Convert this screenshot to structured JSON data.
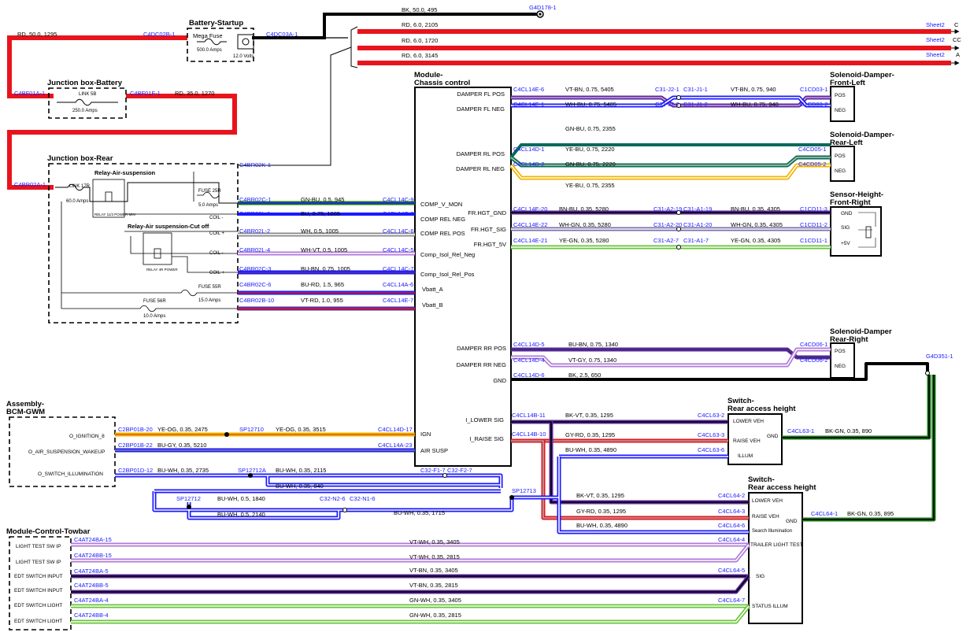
{
  "components": {
    "battery": {
      "title": "Battery-Startup",
      "fuse_label": "Mega Fuse",
      "fuse_rating": "500.0 Amps",
      "volts": "12.0 Volts"
    },
    "jb_battery": {
      "title": "Junction box-Battery",
      "link": "LINK 5B",
      "rating": "250.0 Amps"
    },
    "jb_rear": {
      "title": "Junction box-Rear",
      "link": "LINK 17R",
      "link_rating": "60.0 Amps",
      "relay1_title": "Relay-Air-suspension",
      "relay1_sub": "RELAY 11/3 POWER MIN",
      "relay2_title": "Relay-Air suspension-Cut off",
      "relay2_sub": "RELAY 4R POWER",
      "fuse25": "FUSE 25R",
      "fuse25_rating": "5.0 Amps",
      "fuse55": "FUSE 55R",
      "fuse55_rating": "15.0 Amps",
      "fuse56": "FUSE 56R",
      "fuse56_rating": "10.0 Amps",
      "coil_minus_1": "COIL -",
      "coil_plus_1": "COIL +",
      "coil_minus_2": "COIL -",
      "coil_plus_2": "COIL +"
    },
    "module": {
      "title1": "Module-",
      "title2": "Chassis control"
    },
    "sd_fl": {
      "t1": "Solenoid-Damper-",
      "t2": "Front-Left",
      "p1": "POS",
      "p2": "NEG"
    },
    "sd_rl": {
      "t1": "Solenoid-Damper-",
      "t2": "Rear-Left",
      "p1": "POS",
      "p2": "NEG"
    },
    "sensor": {
      "t1": "Sensor-Height-",
      "t2": "Front-Right",
      "p1": "GND",
      "p2": "SIG",
      "p3": "+5V"
    },
    "sd_rr": {
      "t1": "Solenoid-Damper",
      "t2": "Rear-Right",
      "p1": "POS",
      "p2": "NEG"
    },
    "bcm": {
      "t1": "Assembly-",
      "t2": "BCM-GWM",
      "p1": "O_IGNITION_8",
      "p2": "O_AIR_SUSPENSION_WAKEUP",
      "p3": "O_SWITCH_ILLUMINATION"
    },
    "sw1": {
      "t1": "Switch-",
      "t2": "Rear access height",
      "p1": "LOWER VEH",
      "p2": "RAISE VEH",
      "p3": "ILLUM",
      "gnd": "GND"
    },
    "sw2": {
      "t1": "Switch-",
      "t2": "Rear access height",
      "p1": "LOWER VEH",
      "p2": "RAISE VEH",
      "p3": "Search Illumination",
      "p4": "TRAILER LIGHT TEST",
      "p5": "SIG",
      "p6": "STATUS ILLUM",
      "gnd": "GND"
    },
    "towbar": {
      "title": "Module-Control-Towbar",
      "p1": "LIGHT TEST SW IP",
      "p2": "LIGHT TEST SW IP",
      "p3": "EDT SWITCH INPUT",
      "p4": "EDT SWITCH INPUT",
      "p5": "EDT SWITCH LIGHT",
      "p6": "EDT SWITCH LIGHT"
    }
  },
  "module_pins": [
    "DAMPER FL POS",
    "DAMPER FL NEG",
    "DAMPER RL POS",
    "DAMPER RL NEG",
    "FR.HGT_GND",
    "FR.HGT_SIG",
    "FR.HGT_5V",
    "COMP_V_MON",
    "COMP REL NEG",
    "COMP REL POS",
    "Comp_Isol_Rel_Neg",
    "Comp_Isol_Rel_Pos",
    "Vbatt_A",
    "Vbatt_B",
    "DAMPER RR POS",
    "DAMPER RR NEG",
    "GND",
    "I_LOWER SIG",
    "I_RAISE SIG",
    "IGN",
    "AIR SUSP"
  ],
  "connectors": [
    "C4DC02B-1",
    "C4DC03A-1",
    "G4D178-1",
    "C4BF01A-1",
    "C4BF01F-1",
    "C4BR02A-1",
    "C4BR02K-1",
    "C4BR02C-1",
    "C4BR02L-6",
    "C4BR02L-2",
    "C4BR02L-4",
    "C4BR02C-3",
    "C4BR02C-6",
    "C4BR02B-10",
    "C4CL14C-9",
    "C4CL14C-8",
    "C4CL14C-6",
    "C4CL14C-5",
    "C4CL14C-7",
    "C4CL14A-6",
    "C4CL14E-7",
    "C4CL14E-6",
    "C4CL14E-1",
    "C31-J2-1",
    "C31-J1-1",
    "C31-J2-2",
    "C31-J1-2",
    "C1CD03-1",
    "C1CD03-2",
    "C4CL14D-1",
    "C4CL14D-2",
    "C4CD05-1",
    "C4CD05-2",
    "C4CL14E-20",
    "C4CL14E-22",
    "C4CL14E-21",
    "C31-A2-19",
    "C31-A1-19",
    "C31-A2-20",
    "C31-A1-20",
    "C31-A2-7",
    "C31-A1-7",
    "C1CD11-3",
    "C1CD11-2",
    "C1CD11-1",
    "C4CL14D-5",
    "C4CL14D-4",
    "C4CL14D-6",
    "C4CD06-1",
    "C4CD06-2",
    "G4D351-1",
    "C4CL14B-11",
    "C4CL14B-10",
    "C4CL63-2",
    "C4CL63-3",
    "C4CL63-6",
    "C4CL63-1",
    "C2BP01B-20",
    "C2BP01B-22",
    "C2BP01D-12",
    "C4CL14D-17",
    "C4CL14A-23",
    "SP12710",
    "SP12712A",
    "SP12712",
    "SP12713",
    "C32-F1-7",
    "C32-F2-7",
    "C32-N2-6",
    "C32-N1-6",
    "C4CL64-2",
    "C4CL64-3",
    "C4CL64-6",
    "C4CL64-1",
    "C4CL64-4",
    "C4CL64-5",
    "C4CL64-7",
    "C4AT24BA-15",
    "C4AT24BB-15",
    "C4AT24BA-5",
    "C4AT24BB-5",
    "C4AT24BA-4",
    "C4AT24BB-4"
  ],
  "wires": [
    "RD, 50.0, 1295",
    "BK, 50.0, 495",
    "RD, 6.0, 2105",
    "RD, 6.0, 1720",
    "RD, 6.0, 3145",
    "RD, 35.0, 1270",
    "GN-BU, 0.5, 945",
    "BU, 0.75, 1005",
    "WH, 0.5, 1005",
    "WH-VT, 0.5, 1005",
    "BU-BN, 0.75, 1005",
    "BU-RD, 1.5, 965",
    "VT-RD, 1.0, 955",
    "VT-BN, 0.75, 5405",
    "VT-BN, 0.75, 940",
    "WH-BU, 0.75, 5405",
    "WH-BU, 0.75, 940",
    "GN-BU, 0.75, 2355",
    "YE-BU, 0.75, 2220",
    "GN-BU, 0.75, 2220",
    "YE-BU, 0.75, 2355",
    "BN-BU, 0.35, 5280",
    "BN-BU, 0.35, 4305",
    "WH-GN, 0.35, 5280",
    "WH-GN, 0.35, 4305",
    "YE-GN, 0.35, 5280",
    "YE-GN, 0.35, 4305",
    "BU-BN, 0.75, 1340",
    "VT-GY, 0.75, 1340",
    "BK, 2.5, 650",
    "BK-VT, 0.35, 1295",
    "GY-RD, 0.35, 1295",
    "BU-WH, 0.35, 4890",
    "BK-GN, 0.35, 890",
    "YE-OG, 0.35, 2475",
    "YE-OG, 0.35, 3515",
    "BU-GY, 0.35, 5210",
    "BU-WH, 0.35, 2735",
    "BU-WH, 0.35, 2115",
    "BU-WH, 0.35, 840",
    "BU-WH, 0.5, 1840",
    "BU-WH, 0.5, 2140",
    "BU-WH, 0.35, 1715",
    "BK-VT, 0.35, 1295",
    "GY-RD, 0.35, 1295",
    "BU-WH, 0.35, 4890",
    "BK-GN, 0.35, 895",
    "VT-WH, 0.35, 3405",
    "VT-WH, 0.35, 2815",
    "VT-BN, 0.35, 3405",
    "VT-BN, 0.35, 2815",
    "GN-WH, 0.35, 3405",
    "GN-WH, 0.35, 2815"
  ],
  "sheets": [
    "Sheet2",
    "Sheet2",
    "Sheet2"
  ],
  "sheet_tags": [
    "C",
    "CC",
    "A"
  ],
  "colors": {
    "red": "#e8141c",
    "black": "#000000",
    "blue": "#1a1aff",
    "violet": "#5a2a9a",
    "green": "#1a7a1a",
    "yellow": "#f0b400",
    "teal": "#0a6a5a",
    "lilac": "#b07ad8",
    "lime": "#6ac43a",
    "pink": "#e3106a"
  }
}
